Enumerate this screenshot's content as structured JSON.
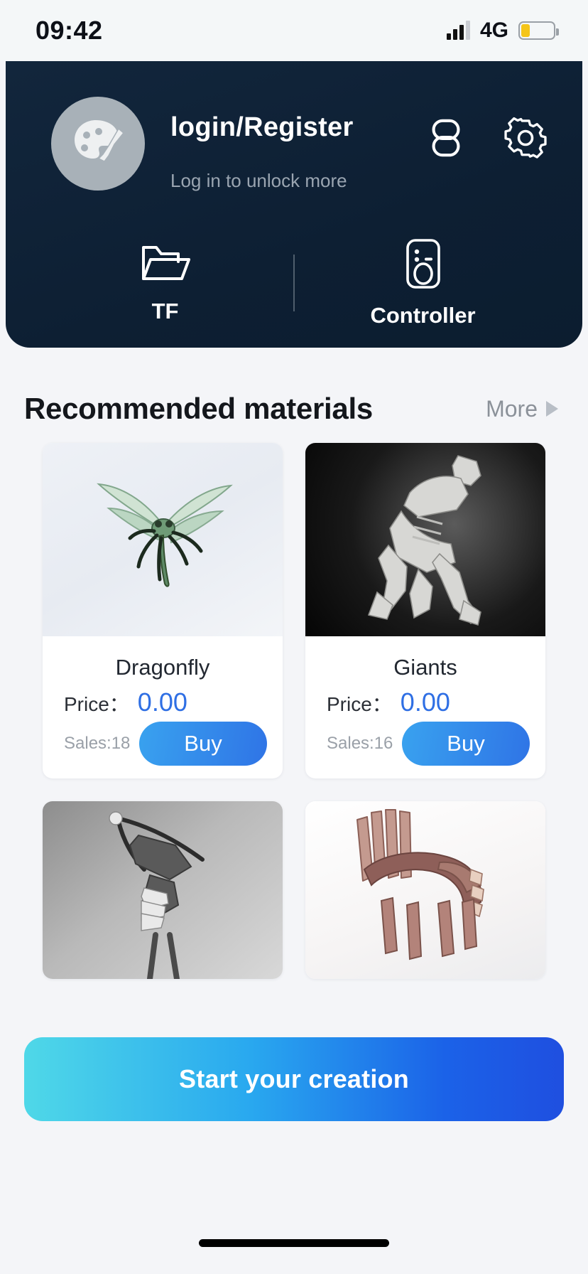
{
  "status_bar": {
    "time": "09:42",
    "network": "4G",
    "signal_icon": "signal-bars-icon",
    "battery_icon": "battery-low-icon",
    "battery_level_percent": 28,
    "battery_color": "#f5c518"
  },
  "header": {
    "background_color": "#10243a",
    "avatar_icon": "palette-brush-avatar-icon",
    "title": "login/Register",
    "subtitle": "Log in to unlock more",
    "actions": [
      {
        "name": "link-icon",
        "label": "link"
      },
      {
        "name": "gear-icon",
        "label": "settings"
      }
    ],
    "quick_actions": [
      {
        "icon": "folder-icon",
        "label": "TF"
      },
      {
        "icon": "controller-icon",
        "label": "Controller"
      }
    ]
  },
  "section": {
    "title": "Recommended materials",
    "more_label": "More",
    "more_icon": "triangle-right-icon"
  },
  "materials": [
    {
      "title": "Dragonfly",
      "thumb": "dragonfly-3d-model",
      "price_label": "Price：",
      "price": "0.00",
      "sales": "Sales:18",
      "buy_label": "Buy"
    },
    {
      "title": "Giants",
      "thumb": "giant-skeleton-3d-model",
      "price_label": "Price：",
      "price": "0.00",
      "sales": "Sales:16",
      "buy_label": "Buy"
    },
    {
      "title": "",
      "thumb": "skeleton-warrior-3d-model",
      "price_label": "",
      "price": "",
      "sales": "",
      "buy_label": ""
    },
    {
      "title": "",
      "thumb": "wooden-dinosaur-3d-model",
      "price_label": "",
      "price": "",
      "sales": "",
      "buy_label": ""
    }
  ],
  "cta": {
    "label": "Start your creation",
    "gradient_start": "#4fd8e8",
    "gradient_end": "#1f4fe0"
  },
  "colors": {
    "price_blue": "#2f6fe4",
    "page_background": "#f4f5f8",
    "card_background": "#ffffff"
  }
}
